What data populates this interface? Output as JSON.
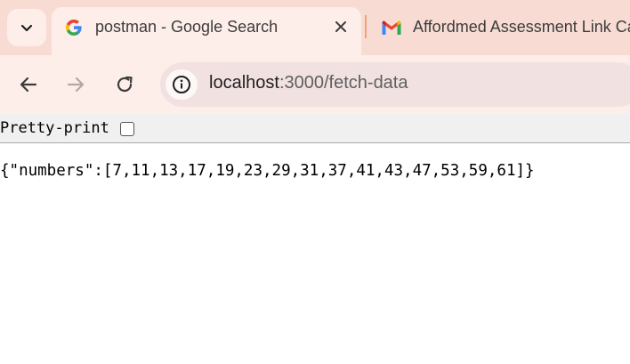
{
  "tabs": [
    {
      "title": "postman - Google Search",
      "favicon": "google-g-icon",
      "active": true
    },
    {
      "title": "Affordmed Assessment Link Ca",
      "favicon": "gmail-m-icon",
      "active": false
    }
  ],
  "address_bar": {
    "host": "localhost",
    "path": ":3000/fetch-data"
  },
  "viewer": {
    "pretty_print_label": "Pretty-print",
    "pretty_print_checked": false,
    "content": "{\"numbers\":[7,11,13,17,19,23,29,31,37,41,43,47,53,59,61]}"
  },
  "colors": {
    "tabstrip": "#f8dcd3",
    "toolbar": "#fdeee9",
    "omnibox": "#f1e2e1"
  }
}
